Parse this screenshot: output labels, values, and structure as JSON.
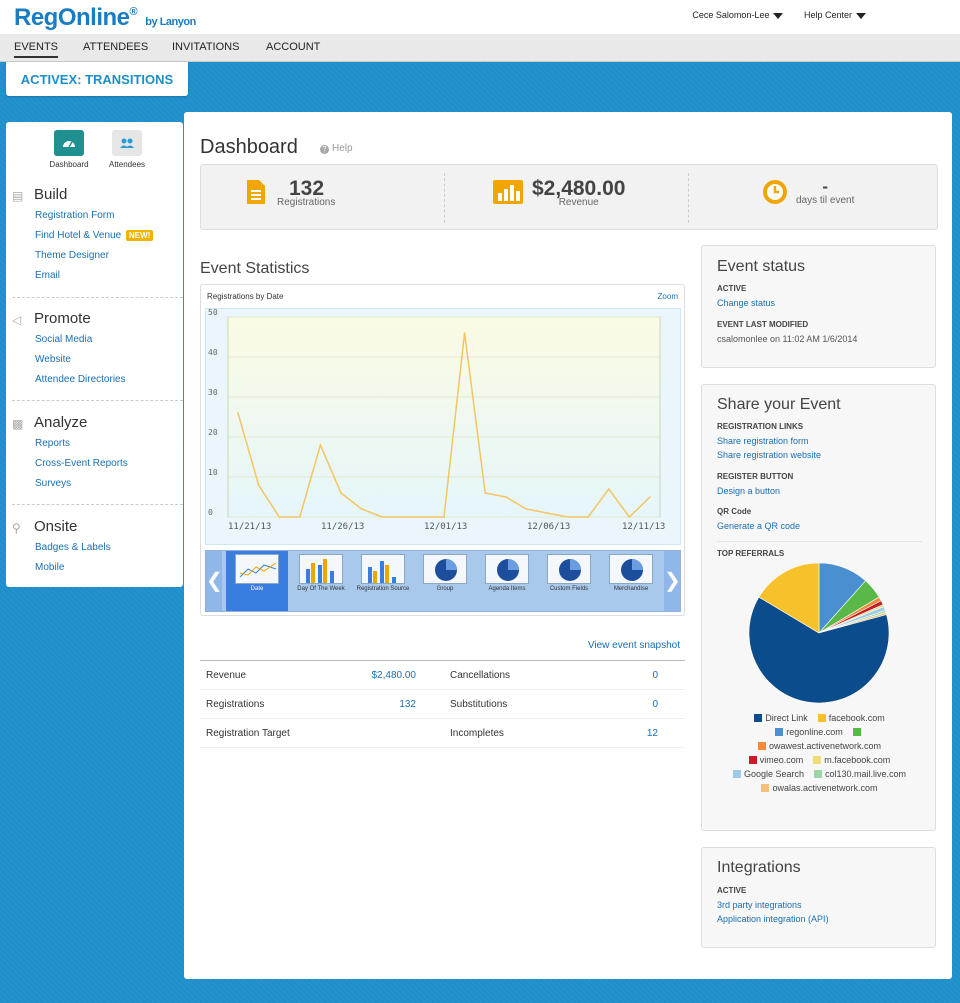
{
  "header": {
    "logo": "RegOnline",
    "logo_reg": "®",
    "logo_by": "by Lanyon",
    "user": "Cece Salomon-Lee",
    "help_center": "Help Center"
  },
  "nav": [
    "EVENTS",
    "ATTENDEES",
    "INVITATIONS",
    "ACCOUNT"
  ],
  "event_title": "ACTIVEX: TRANSITIONS",
  "sidebar": {
    "tabs": [
      "Dashboard",
      "Attendees"
    ],
    "sections": [
      {
        "title": "Build",
        "links": [
          "Registration Form",
          "Find Hotel & Venue",
          "Theme Designer",
          "Email"
        ]
      },
      {
        "title": "Promote",
        "links": [
          "Social Media",
          "Website",
          "Attendee Directories"
        ]
      },
      {
        "title": "Analyze",
        "links": [
          "Reports",
          "Cross-Event Reports",
          "Surveys"
        ]
      },
      {
        "title": "Onsite",
        "links": [
          "Badges & Labels",
          "Mobile"
        ]
      }
    ],
    "new_badge": "NEW!"
  },
  "dashboard": {
    "title": "Dashboard",
    "help": "Help",
    "registrations_value": "132",
    "registrations_label": "Registrations",
    "revenue_value": "$2,480.00",
    "revenue_label": "Revenue",
    "days_value": "-",
    "days_label": "days til event"
  },
  "event_statistics": {
    "title": "Event Statistics",
    "chart_title": "Registrations by Date",
    "zoom": "Zoom",
    "thumbs": [
      "Date",
      "Day Of The Week",
      "Registration Source",
      "Group",
      "Agenda Items",
      "Custom Fields",
      "Merchandise"
    ]
  },
  "chart_data": {
    "type": "line",
    "title": "Registrations by Date",
    "xlabel": "",
    "ylabel": "",
    "ylim": [
      0,
      50
    ],
    "yticks": [
      0,
      10,
      20,
      30,
      40,
      50
    ],
    "xticks": [
      "11/21/13",
      "11/26/13",
      "12/01/13",
      "12/06/13",
      "12/11/13"
    ],
    "series": [
      {
        "color": "#f5c463",
        "x": [
          "11/21/13",
          "11/22/13",
          "11/23/13",
          "11/24/13",
          "11/25/13",
          "11/26/13",
          "11/27/13",
          "11/28/13",
          "11/29/13",
          "11/30/13",
          "12/01/13",
          "12/02/13",
          "12/03/13",
          "12/04/13",
          "12/05/13",
          "12/06/13",
          "12/07/13",
          "12/08/13",
          "12/09/13",
          "12/10/13",
          "12/11/13"
        ],
        "values": [
          26,
          8,
          0,
          0,
          18,
          6,
          2,
          0,
          0,
          0,
          0,
          46,
          6,
          5,
          2,
          1,
          0,
          0,
          7,
          0,
          5
        ]
      }
    ]
  },
  "snapshot": "View event snapshot",
  "summary": {
    "rows": [
      {
        "label": "Revenue",
        "value": "$2,480.00",
        "label2": "Cancellations",
        "value2": "0"
      },
      {
        "label": "Registrations",
        "value": "132",
        "label2": "Substitutions",
        "value2": "0"
      },
      {
        "label": "Registration Target",
        "value": "",
        "label2": "Incompletes",
        "value2": "12"
      }
    ]
  },
  "event_status": {
    "title": "Event status",
    "status": "ACTIVE",
    "change": "Change status",
    "modified_label": "EVENT LAST MODIFIED",
    "modified_value": "csalomonlee on 11:02 AM 1/6/2014"
  },
  "share": {
    "title": "Share your Event",
    "links_label": "REGISTRATION LINKS",
    "share_form": "Share registration form",
    "share_website": "Share registration website",
    "button_label": "REGISTER BUTTON",
    "design_button": "Design a button",
    "qr_label": "QR Code",
    "qr_link": "Generate a QR code",
    "referrals_label": "TOP REFERRALS"
  },
  "referrals": [
    {
      "name": "Direct Link",
      "value": 65,
      "color": "#0a4c8c"
    },
    {
      "name": "facebook.com",
      "value": 17,
      "color": "#f7c12b"
    },
    {
      "name": "regonline.com",
      "value": 12,
      "color": "#4a8fd0"
    },
    {
      "name": "",
      "value": 5,
      "color": "#5ab848"
    },
    {
      "name": "owawest.activenetwork.com",
      "value": 1,
      "color": "#f08a3c"
    },
    {
      "name": "vimeo.com",
      "value": 1,
      "color": "#c41e26"
    },
    {
      "name": "m.facebook.com",
      "value": 0.5,
      "color": "#f2dc7a"
    },
    {
      "name": "Google Search",
      "value": 1,
      "color": "#9fcbea"
    },
    {
      "name": "col130.mail.live.com",
      "value": 0.5,
      "color": "#9ed6a5"
    },
    {
      "name": "owalas.activenetwork.com",
      "value": 0.5,
      "color": "#f2c27a"
    }
  ],
  "integrations": {
    "title": "Integrations",
    "status": "ACTIVE",
    "third_party": "3rd party integrations",
    "api": "Application integration (API)"
  }
}
